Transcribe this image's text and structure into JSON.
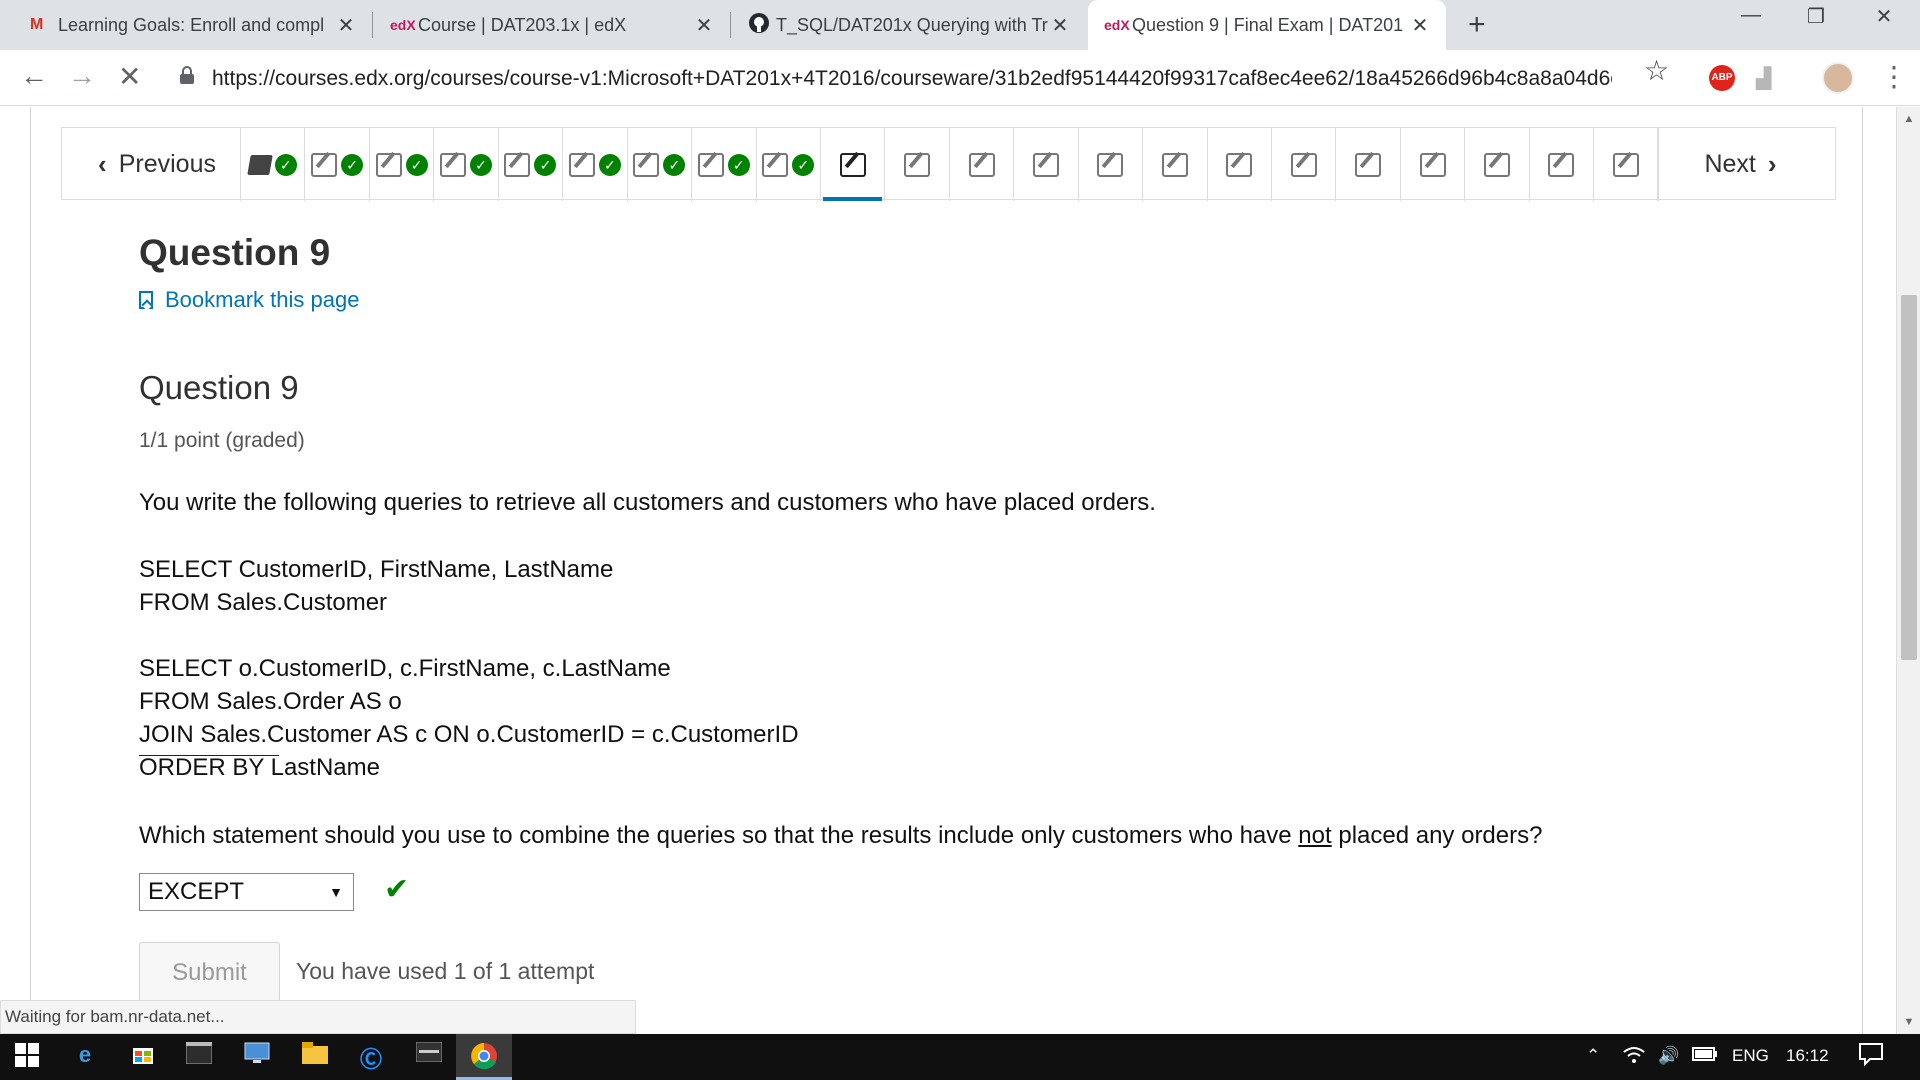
{
  "browser": {
    "tabs": [
      {
        "favicon": "M",
        "title": "Learning Goals: Enroll and compl",
        "active": false
      },
      {
        "favicon": "edX",
        "title": "Course | DAT203.1x | edX",
        "active": false
      },
      {
        "favicon": "github-icon",
        "title": "T_SQL/DAT201x Querying with Tr",
        "active": false
      },
      {
        "favicon": "edX",
        "title": "Question 9 | Final Exam | DAT201",
        "active": true
      }
    ],
    "url": "https://courses.edx.org/courses/course-v1:Microsoft+DAT201x+4T2016/courseware/31b2edf95144420f99317caf8ec4ee62/18a45266d96b4c8a8a04d6e...",
    "abp_label": "ABP"
  },
  "sequence": {
    "prev_label": "Previous",
    "next_label": "Next",
    "items": [
      {
        "type": "book",
        "done": true
      },
      {
        "type": "problem",
        "done": true
      },
      {
        "type": "problem",
        "done": true
      },
      {
        "type": "problem",
        "done": true
      },
      {
        "type": "problem",
        "done": true
      },
      {
        "type": "problem",
        "done": true
      },
      {
        "type": "problem",
        "done": true
      },
      {
        "type": "problem",
        "done": true
      },
      {
        "type": "problem",
        "done": true
      },
      {
        "type": "problem",
        "done": false,
        "active": true
      },
      {
        "type": "problem",
        "done": false
      },
      {
        "type": "problem",
        "done": false
      },
      {
        "type": "problem",
        "done": false
      },
      {
        "type": "problem",
        "done": false
      },
      {
        "type": "problem",
        "done": false
      },
      {
        "type": "problem",
        "done": false
      },
      {
        "type": "problem",
        "done": false
      },
      {
        "type": "problem",
        "done": false
      },
      {
        "type": "problem",
        "done": false
      },
      {
        "type": "problem",
        "done": false
      },
      {
        "type": "problem",
        "done": false
      },
      {
        "type": "problem",
        "done": false
      }
    ]
  },
  "page": {
    "title": "Question 9",
    "bookmark": "Bookmark this page"
  },
  "problem": {
    "title": "Question 9",
    "points": "1/1 point (graded)",
    "intro": "You write the following queries to retrieve all customers and customers who have placed orders.",
    "query1": [
      "SELECT CustomerID, FirstName, LastName",
      "FROM Sales.Customer"
    ],
    "query2": [
      "SELECT o.CustomerID, c.FirstName, c.LastName",
      "FROM Sales.Order AS o",
      "JOIN Sales.Customer AS c ON o.CustomerID = c.CustomerID",
      "ORDER BY LastName"
    ],
    "question_pre": "Which statement should you use to combine the queries so that the results include only customers who have ",
    "question_emph": "not",
    "question_post": " placed any orders?",
    "selected": "EXCEPT",
    "submit_label": "Submit",
    "attempts": "You have used 1 of 1 attempt"
  },
  "status": "Waiting for bam.nr-data.net...",
  "taskbar": {
    "lang": "ENG",
    "time": "16:12"
  },
  "colors": {
    "accent": "#0075b4",
    "success": "#008100"
  }
}
